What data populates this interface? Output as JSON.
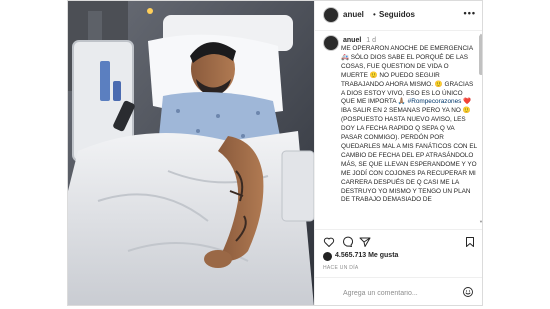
{
  "post": {
    "username": "anuel",
    "separator": "•",
    "follow_status": "Seguidos",
    "more_icon": "more-horizontal-icon"
  },
  "caption": {
    "username": "anuel",
    "time": "1 d",
    "text_a": "Me operaron anoche de emergencia 🚑 sólo Dios sabe el porqué de las cosas, fue question de vida o muerte 🙂 no puedo seguir trabajando ahora mismo. 🙂 gracias a Dios estoy vivo, eso es lo único que me importa 🙏🏽",
    "hashtag": "#Rompecorazones",
    "text_b": "❤️ iba salir en 2 semanas pero ya no 🙂 (pospuesto hasta nuevo aviso, les doy la fecha rapido q sepa q va pasar conmigo). perdón por quedarles mal a mis fanáticos con el cambio de fecha del ep atrasándolo más, se que llevan esperandome y yo me jodí con cojones pa recuperar mi carrera después de q casi me la destruyo yo mismo y tengo un plan de trabajo demasiado de"
  },
  "actions": {
    "like_icon": "heart-icon",
    "comment_icon": "comment-icon",
    "share_icon": "share-icon",
    "save_icon": "bookmark-icon"
  },
  "likes": {
    "count_text": "4.565.713 Me gusta"
  },
  "time_ago": "HACE UN DÍA",
  "comment": {
    "placeholder": "Agrega un comentario...",
    "emoji_icon": "emoji-smile-icon"
  },
  "colors": {
    "border": "#dbdbdb",
    "text": "#262626",
    "secondary_text": "#8e8e8e",
    "hashtag": "#00376b"
  }
}
